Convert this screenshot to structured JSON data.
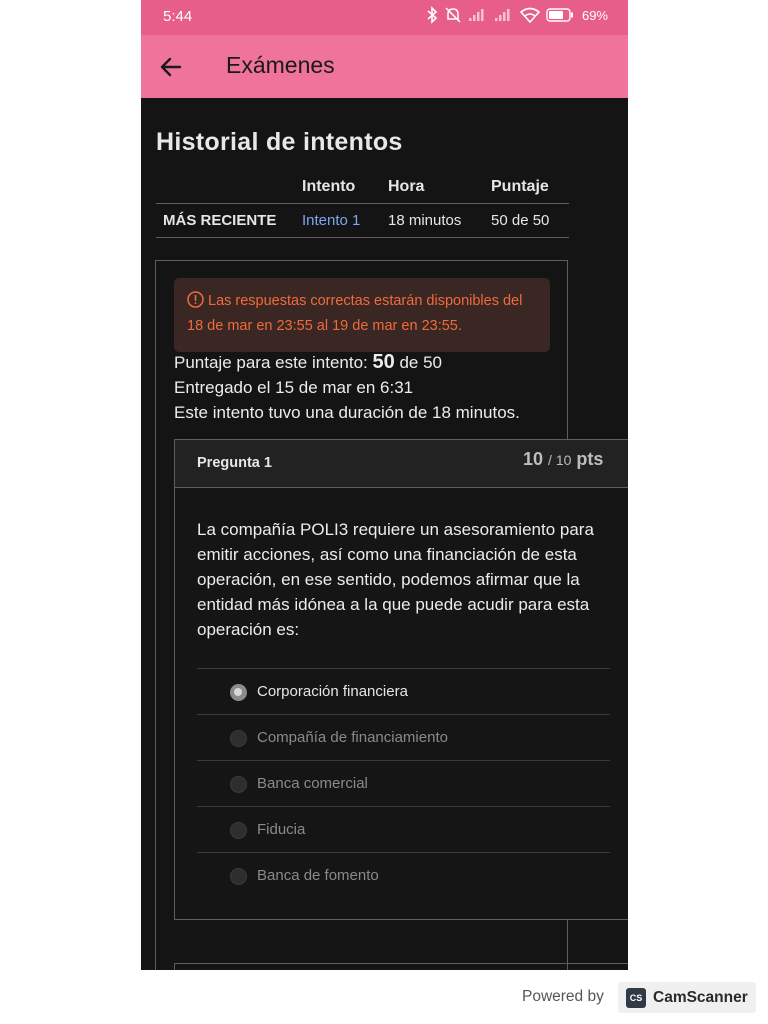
{
  "status_bar": {
    "time": "5:44",
    "battery": "69%"
  },
  "app_bar": {
    "title": "Exámenes"
  },
  "history": {
    "title": "Historial de intentos",
    "headers": [
      "",
      "Intento",
      "Hora",
      "Puntaje"
    ],
    "row": {
      "label": "MÁS RECIENTE",
      "attempt": "Intento 1",
      "time": "18 minutos",
      "score": "50 de 50"
    }
  },
  "alert": {
    "text": "Las respuestas correctas estarán disponibles del 18 de mar en 23:55 al 19 de mar en 23:55."
  },
  "attempt": {
    "score_prefix": "Puntaje para este intento:",
    "score": "50",
    "score_suffix": "de 50",
    "submitted": "Entregado el 15 de mar en 6:31",
    "duration": "Este intento tuvo una duración de 18 minutos."
  },
  "question": {
    "label": "Pregunta 1",
    "points": "10",
    "points_total": "/ 10",
    "points_unit": "pts",
    "text": "La compañía POLI3 requiere un asesoramiento para emitir acciones, así como una financiación de esta operación, en ese sentido, podemos afirmar que la entidad más idónea a la que puede acudir para esta operación es:",
    "options": [
      {
        "label": "Corporación financiera",
        "selected": true
      },
      {
        "label": "Compañía de financiamiento",
        "selected": false
      },
      {
        "label": "Banca comercial",
        "selected": false
      },
      {
        "label": "Fiducia",
        "selected": false
      },
      {
        "label": "Banca de fomento",
        "selected": false
      }
    ]
  },
  "watermark": {
    "powered_by": "Powered by",
    "logo": "CS",
    "brand": "CamScanner"
  },
  "colors": {
    "status_bar": "#e75e8a",
    "app_bar": "#ef739a",
    "background": "#141414",
    "alert_text": "#ef6b3d",
    "link": "#7ca8ec"
  }
}
